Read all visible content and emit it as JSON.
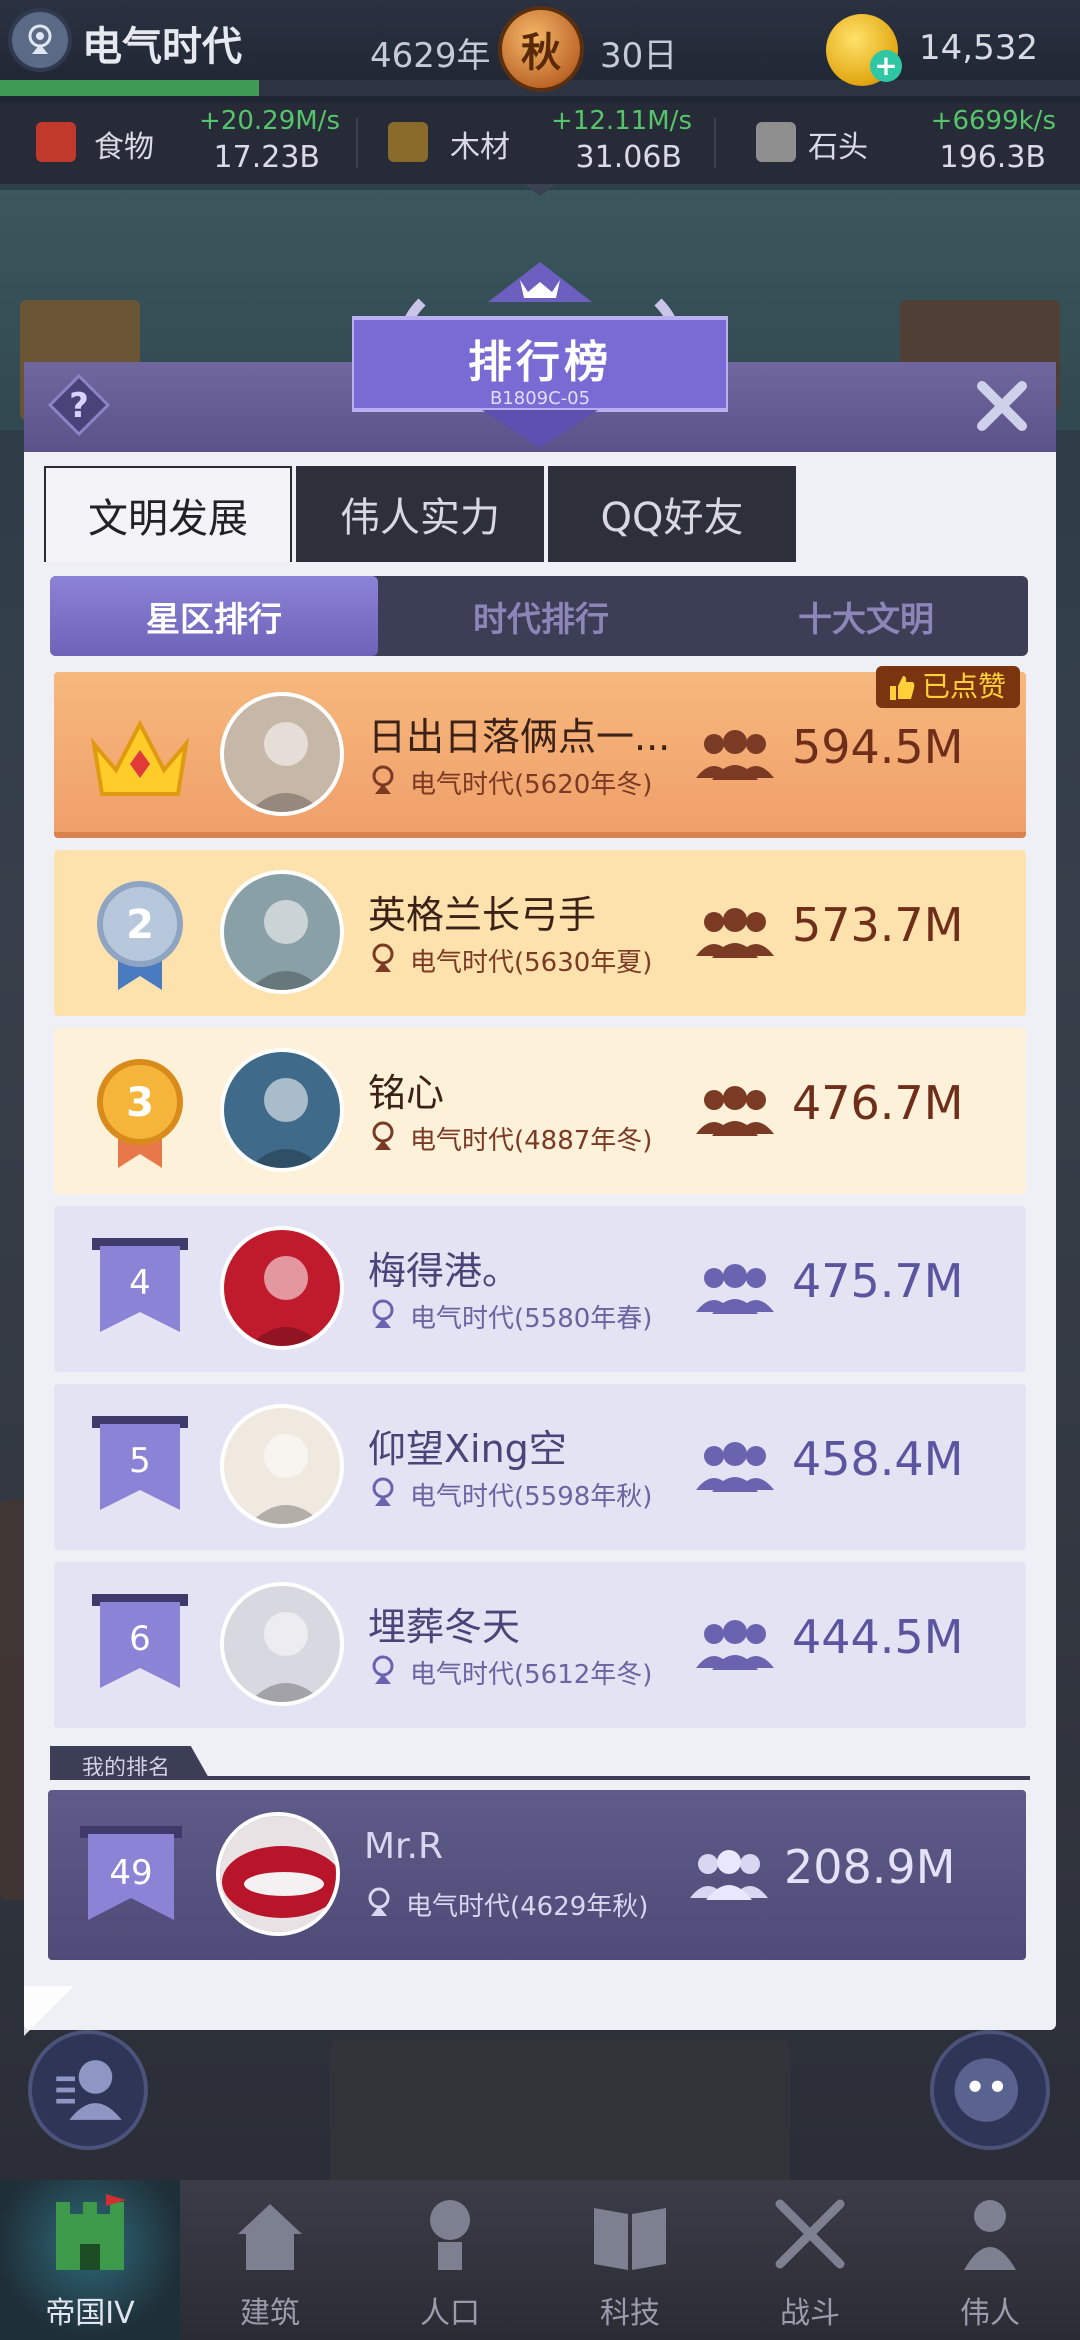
{
  "top": {
    "era_name": "电气时代",
    "year": "4629年",
    "season": "秋",
    "day": "30日",
    "gold": "14,532",
    "era_progress": 0.24
  },
  "resources": [
    {
      "name": "食物",
      "rate": "+20.29M/s",
      "amount": "17.23B",
      "icon": "meat-icon"
    },
    {
      "name": "木材",
      "rate": "+12.11M/s",
      "amount": "31.06B",
      "icon": "wood-icon"
    },
    {
      "name": "石头",
      "rate": "+6699k/s",
      "amount": "196.3B",
      "icon": "stone-icon"
    }
  ],
  "panel": {
    "title": "排行榜",
    "subtitle": "B1809C-05"
  },
  "tabs": [
    "文明发展",
    "伟人实力",
    "QQ好友"
  ],
  "subtabs": [
    "星区排行",
    "时代排行",
    "十大文明"
  ],
  "liked_badge": "已点赞",
  "ranking": [
    {
      "rank": "1",
      "name": "日出日落俩点一...",
      "era": "电气时代(5620年冬)",
      "power": "594.5M"
    },
    {
      "rank": "2",
      "name": "英格兰长弓手",
      "era": "电气时代(5630年夏)",
      "power": "573.7M"
    },
    {
      "rank": "3",
      "name": "铭心",
      "era": "电气时代(4887年冬)",
      "power": "476.7M"
    },
    {
      "rank": "4",
      "name": "梅得港。",
      "era": "电气时代(5580年春)",
      "power": "475.7M"
    },
    {
      "rank": "5",
      "name": "仰望Ⅹing空",
      "era": "电气时代(5598年秋)",
      "power": "458.4M"
    },
    {
      "rank": "6",
      "name": "埋葬冬天",
      "era": "电气时代(5612年冬)",
      "power": "444.5M"
    }
  ],
  "my_rank": {
    "label": "我的排名",
    "rank": "49",
    "name": "Mr.R",
    "era": "电气时代(4629年秋)",
    "power": "208.9M"
  },
  "nav": [
    {
      "label": "帝国IV",
      "icon": "castle-icon",
      "active": true
    },
    {
      "label": "建筑",
      "icon": "house-icon"
    },
    {
      "label": "人口",
      "icon": "person-icon"
    },
    {
      "label": "科技",
      "icon": "book-icon"
    },
    {
      "label": "战斗",
      "icon": "swords-icon"
    },
    {
      "label": "伟人",
      "icon": "hero-icon"
    }
  ]
}
